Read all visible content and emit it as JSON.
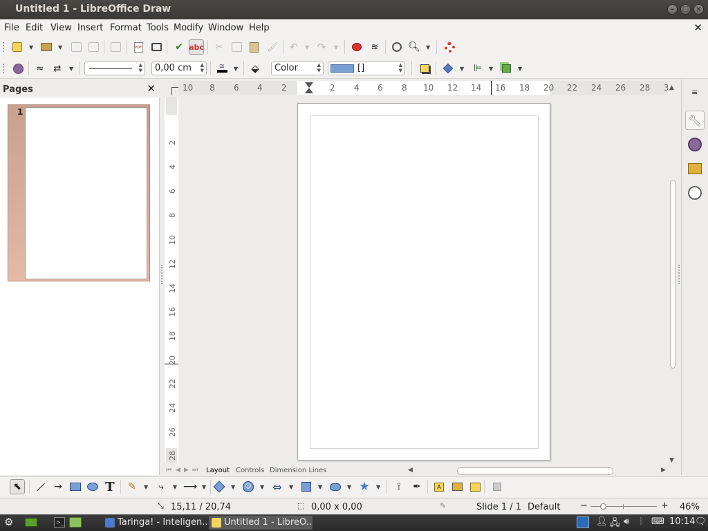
{
  "window": {
    "title": "Untitled 1 - LibreOffice Draw"
  },
  "menu": [
    "File",
    "Edit",
    "View",
    "Insert",
    "Format",
    "Tools",
    "Modify",
    "Window",
    "Help"
  ],
  "toolbar2": {
    "line_width": "0,00 cm",
    "area_style": "Color",
    "area_color_name": "[]",
    "area_color": "#7a9fd4"
  },
  "pages_panel": {
    "title": "Pages",
    "pages": [
      {
        "number": "1"
      }
    ]
  },
  "ruler": {
    "horizontal": [
      "10",
      "8",
      "6",
      "4",
      "2",
      "2",
      "4",
      "6",
      "8",
      "10",
      "12",
      "14",
      "16",
      "18",
      "20",
      "22",
      "24",
      "26",
      "28",
      "3"
    ],
    "vertical": [
      "2",
      "4",
      "6",
      "8",
      "10",
      "12",
      "14",
      "16",
      "18",
      "20",
      "22",
      "24",
      "26",
      "28"
    ]
  },
  "layer_tabs": [
    "Layout",
    "Controls",
    "Dimension Lines"
  ],
  "statusbar": {
    "position": "15,11 / 20,74",
    "size": "0,00 x 0,00",
    "slide": "Slide 1 / 1",
    "master": "Default",
    "zoom": "46%"
  },
  "taskbar": {
    "tasks": [
      {
        "label": "Taringa! - Inteligen...",
        "active": false
      },
      {
        "label": "Untitled 1 - LibreO...",
        "active": true
      }
    ],
    "clock": "10:14"
  }
}
